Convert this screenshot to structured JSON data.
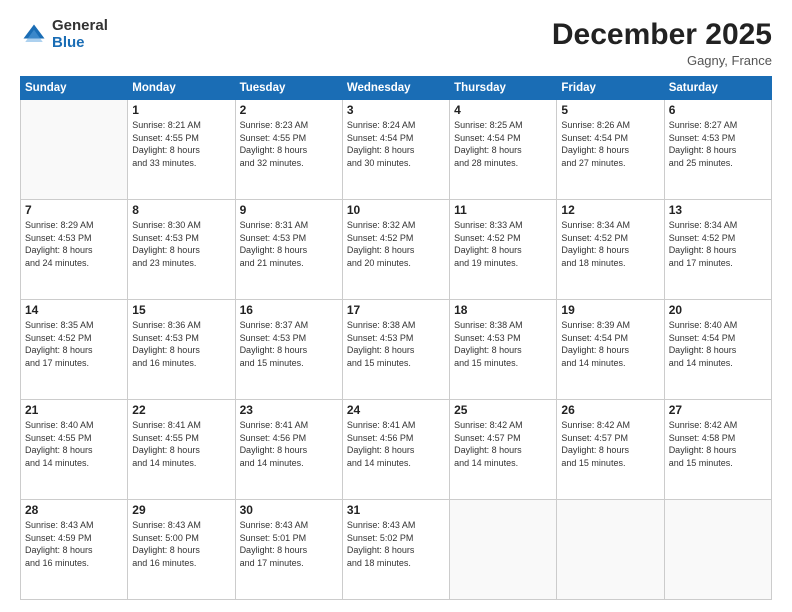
{
  "logo": {
    "general": "General",
    "blue": "Blue"
  },
  "header": {
    "month": "December 2025",
    "location": "Gagny, France"
  },
  "weekdays": [
    "Sunday",
    "Monday",
    "Tuesday",
    "Wednesday",
    "Thursday",
    "Friday",
    "Saturday"
  ],
  "weeks": [
    [
      {
        "day": "",
        "info": ""
      },
      {
        "day": "1",
        "info": "Sunrise: 8:21 AM\nSunset: 4:55 PM\nDaylight: 8 hours\nand 33 minutes."
      },
      {
        "day": "2",
        "info": "Sunrise: 8:23 AM\nSunset: 4:55 PM\nDaylight: 8 hours\nand 32 minutes."
      },
      {
        "day": "3",
        "info": "Sunrise: 8:24 AM\nSunset: 4:54 PM\nDaylight: 8 hours\nand 30 minutes."
      },
      {
        "day": "4",
        "info": "Sunrise: 8:25 AM\nSunset: 4:54 PM\nDaylight: 8 hours\nand 28 minutes."
      },
      {
        "day": "5",
        "info": "Sunrise: 8:26 AM\nSunset: 4:54 PM\nDaylight: 8 hours\nand 27 minutes."
      },
      {
        "day": "6",
        "info": "Sunrise: 8:27 AM\nSunset: 4:53 PM\nDaylight: 8 hours\nand 25 minutes."
      }
    ],
    [
      {
        "day": "7",
        "info": "Sunrise: 8:29 AM\nSunset: 4:53 PM\nDaylight: 8 hours\nand 24 minutes."
      },
      {
        "day": "8",
        "info": "Sunrise: 8:30 AM\nSunset: 4:53 PM\nDaylight: 8 hours\nand 23 minutes."
      },
      {
        "day": "9",
        "info": "Sunrise: 8:31 AM\nSunset: 4:53 PM\nDaylight: 8 hours\nand 21 minutes."
      },
      {
        "day": "10",
        "info": "Sunrise: 8:32 AM\nSunset: 4:52 PM\nDaylight: 8 hours\nand 20 minutes."
      },
      {
        "day": "11",
        "info": "Sunrise: 8:33 AM\nSunset: 4:52 PM\nDaylight: 8 hours\nand 19 minutes."
      },
      {
        "day": "12",
        "info": "Sunrise: 8:34 AM\nSunset: 4:52 PM\nDaylight: 8 hours\nand 18 minutes."
      },
      {
        "day": "13",
        "info": "Sunrise: 8:34 AM\nSunset: 4:52 PM\nDaylight: 8 hours\nand 17 minutes."
      }
    ],
    [
      {
        "day": "14",
        "info": "Sunrise: 8:35 AM\nSunset: 4:52 PM\nDaylight: 8 hours\nand 17 minutes."
      },
      {
        "day": "15",
        "info": "Sunrise: 8:36 AM\nSunset: 4:53 PM\nDaylight: 8 hours\nand 16 minutes."
      },
      {
        "day": "16",
        "info": "Sunrise: 8:37 AM\nSunset: 4:53 PM\nDaylight: 8 hours\nand 15 minutes."
      },
      {
        "day": "17",
        "info": "Sunrise: 8:38 AM\nSunset: 4:53 PM\nDaylight: 8 hours\nand 15 minutes."
      },
      {
        "day": "18",
        "info": "Sunrise: 8:38 AM\nSunset: 4:53 PM\nDaylight: 8 hours\nand 15 minutes."
      },
      {
        "day": "19",
        "info": "Sunrise: 8:39 AM\nSunset: 4:54 PM\nDaylight: 8 hours\nand 14 minutes."
      },
      {
        "day": "20",
        "info": "Sunrise: 8:40 AM\nSunset: 4:54 PM\nDaylight: 8 hours\nand 14 minutes."
      }
    ],
    [
      {
        "day": "21",
        "info": "Sunrise: 8:40 AM\nSunset: 4:55 PM\nDaylight: 8 hours\nand 14 minutes."
      },
      {
        "day": "22",
        "info": "Sunrise: 8:41 AM\nSunset: 4:55 PM\nDaylight: 8 hours\nand 14 minutes."
      },
      {
        "day": "23",
        "info": "Sunrise: 8:41 AM\nSunset: 4:56 PM\nDaylight: 8 hours\nand 14 minutes."
      },
      {
        "day": "24",
        "info": "Sunrise: 8:41 AM\nSunset: 4:56 PM\nDaylight: 8 hours\nand 14 minutes."
      },
      {
        "day": "25",
        "info": "Sunrise: 8:42 AM\nSunset: 4:57 PM\nDaylight: 8 hours\nand 14 minutes."
      },
      {
        "day": "26",
        "info": "Sunrise: 8:42 AM\nSunset: 4:57 PM\nDaylight: 8 hours\nand 15 minutes."
      },
      {
        "day": "27",
        "info": "Sunrise: 8:42 AM\nSunset: 4:58 PM\nDaylight: 8 hours\nand 15 minutes."
      }
    ],
    [
      {
        "day": "28",
        "info": "Sunrise: 8:43 AM\nSunset: 4:59 PM\nDaylight: 8 hours\nand 16 minutes."
      },
      {
        "day": "29",
        "info": "Sunrise: 8:43 AM\nSunset: 5:00 PM\nDaylight: 8 hours\nand 16 minutes."
      },
      {
        "day": "30",
        "info": "Sunrise: 8:43 AM\nSunset: 5:01 PM\nDaylight: 8 hours\nand 17 minutes."
      },
      {
        "day": "31",
        "info": "Sunrise: 8:43 AM\nSunset: 5:02 PM\nDaylight: 8 hours\nand 18 minutes."
      },
      {
        "day": "",
        "info": ""
      },
      {
        "day": "",
        "info": ""
      },
      {
        "day": "",
        "info": ""
      }
    ]
  ]
}
